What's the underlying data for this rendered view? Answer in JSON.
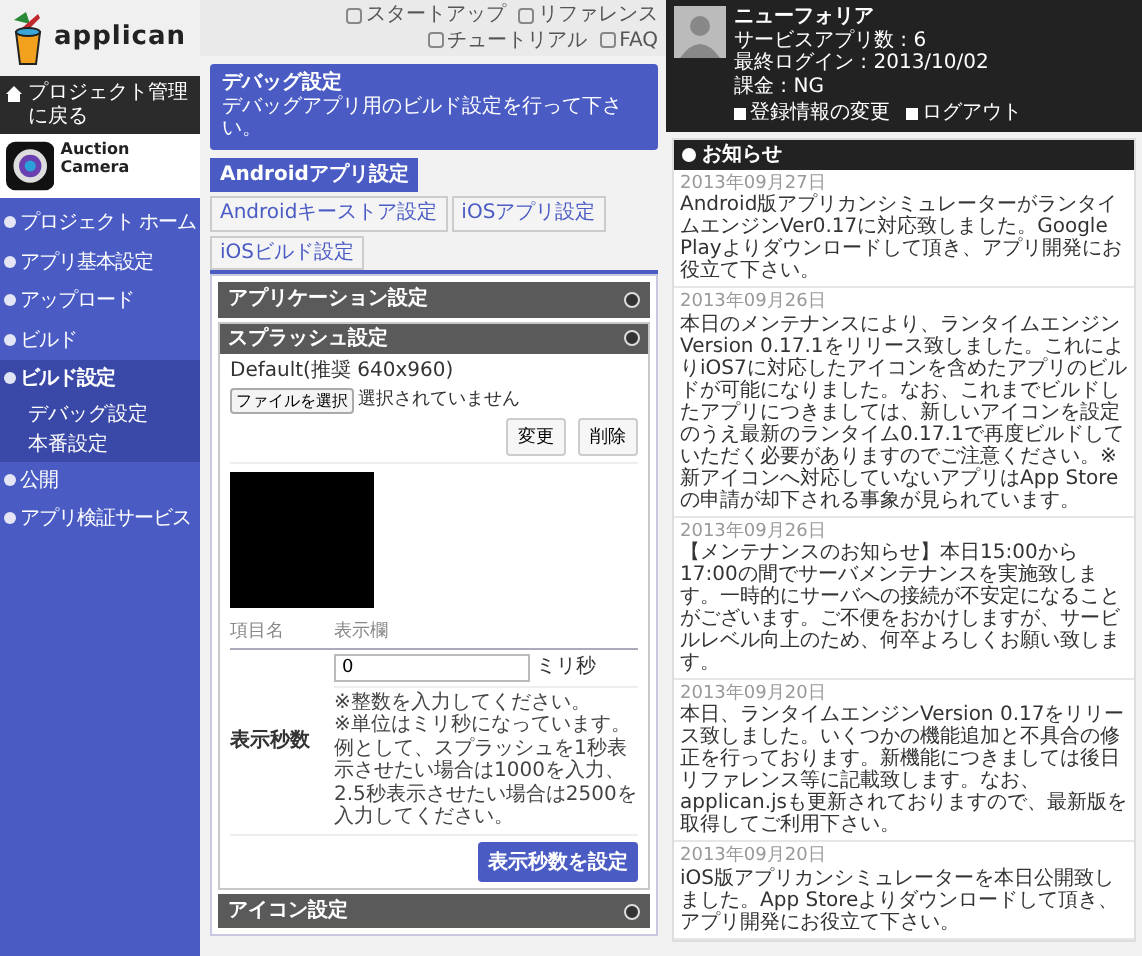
{
  "logo": {
    "text": "applican"
  },
  "sidebar": {
    "back_link": "プロジェクト管理に戻る",
    "project": {
      "name": "Auction Camera"
    },
    "items": [
      {
        "label": "プロジェクト ホーム",
        "selected": false
      },
      {
        "label": "アプリ基本設定",
        "selected": false
      },
      {
        "label": "アップロード",
        "selected": false
      },
      {
        "label": "ビルド",
        "selected": false
      },
      {
        "label": "ビルド設定",
        "selected": true,
        "children": [
          {
            "label": "デバッグ設定",
            "selected": false
          },
          {
            "label": "本番設定",
            "selected": false
          }
        ]
      },
      {
        "label": "公開",
        "selected": false
      },
      {
        "label": "アプリ検証サービス",
        "selected": false
      }
    ]
  },
  "top_links": [
    "スタートアップ",
    "リファレンス",
    "チュートリアル",
    "FAQ"
  ],
  "header": {
    "title": "デバッグ設定",
    "subtitle": "デバッグアプリ用のビルド設定を行って下さい。"
  },
  "tabs": [
    {
      "label": "Androidアプリ設定",
      "selected": true
    },
    {
      "label": "Androidキーストア設定",
      "selected": false
    },
    {
      "label": "iOSアプリ設定",
      "selected": false
    },
    {
      "label": "iOSビルド設定",
      "selected": false
    }
  ],
  "sections": [
    {
      "title": "アプリケーション設定",
      "expanded": false
    },
    {
      "title": "スプラッシュ設定",
      "expanded": true
    },
    {
      "title": "アイコン設定",
      "expanded": false
    }
  ],
  "splash": {
    "file_label": "Default(推奨 640x960)",
    "file_button": "ファイルを選択",
    "file_status": "選択されていません",
    "buttons": [
      "変更",
      "削除"
    ],
    "columns": [
      "項目名",
      "表示欄"
    ],
    "row_label": "表示秒数",
    "value": "0",
    "unit": "ミリ秒",
    "notes": [
      "※整数を入力してください。",
      "※単位はミリ秒になっています。例として、スプラッシュを1秒表示させたい場合は1000を入力、2.5秒表示させたい場合は2500を入力してください。"
    ],
    "submit": "表示秒数を設定"
  },
  "user": {
    "name": "ニューフォリア",
    "lines": [
      "サービスアプリ数 : 6",
      "最終ログイン : 2013/10/02",
      "課金 : NG"
    ],
    "links": [
      "登録情報の変更",
      "ログアウト"
    ]
  },
  "news": {
    "title": "お知らせ",
    "items": [
      {
        "date": "2013年09月27日",
        "text": "Android版アプリカンシミュレーターがランタイムエンジンVer0.17に対応致しました。Google Playよりダウンロードして頂き、アプリ開発にお役立て下さい。"
      },
      {
        "date": "2013年09月26日",
        "text": "本日のメンテナンスにより、ランタイムエンジンVersion 0.17.1をリリース致しました。これによりiOS7に対応したアイコンを含めたアプリのビルドが可能になりました。なお、これまでビルドしたアプリにつきましては、新しいアイコンを設定のうえ最新のランタイム0.17.1で再度ビルドしていただく必要がありますのでご注意ください。※新アイコンへ対応していないアプリはApp Storeの申請が却下される事象が見られています。"
      },
      {
        "date": "2013年09月26日",
        "text": "【メンテナンスのお知らせ】本日15:00から17:00の間でサーバメンテナンスを実施致します。一時的にサーバへの接続が不安定になることがございます。ご不便をおかけしますが、サービルレベル向上のため、何卒よろしくお願い致します。"
      },
      {
        "date": "2013年09月20日",
        "text": "本日、ランタイムエンジンVersion 0.17をリリース致しました。いくつかの機能追加と不具合の修正を行っております。新機能につきましては後日リファレンス等に記載致します。なお、applican.jsも更新されておりますので、最新版を取得してご利用下さい。"
      },
      {
        "date": "2013年09月20日",
        "text": "iOS版アプリカンシミュレーターを本日公開致しました。App Storeよりダウンロードして頂き、アプリ開発にお役立て下さい。"
      }
    ]
  }
}
